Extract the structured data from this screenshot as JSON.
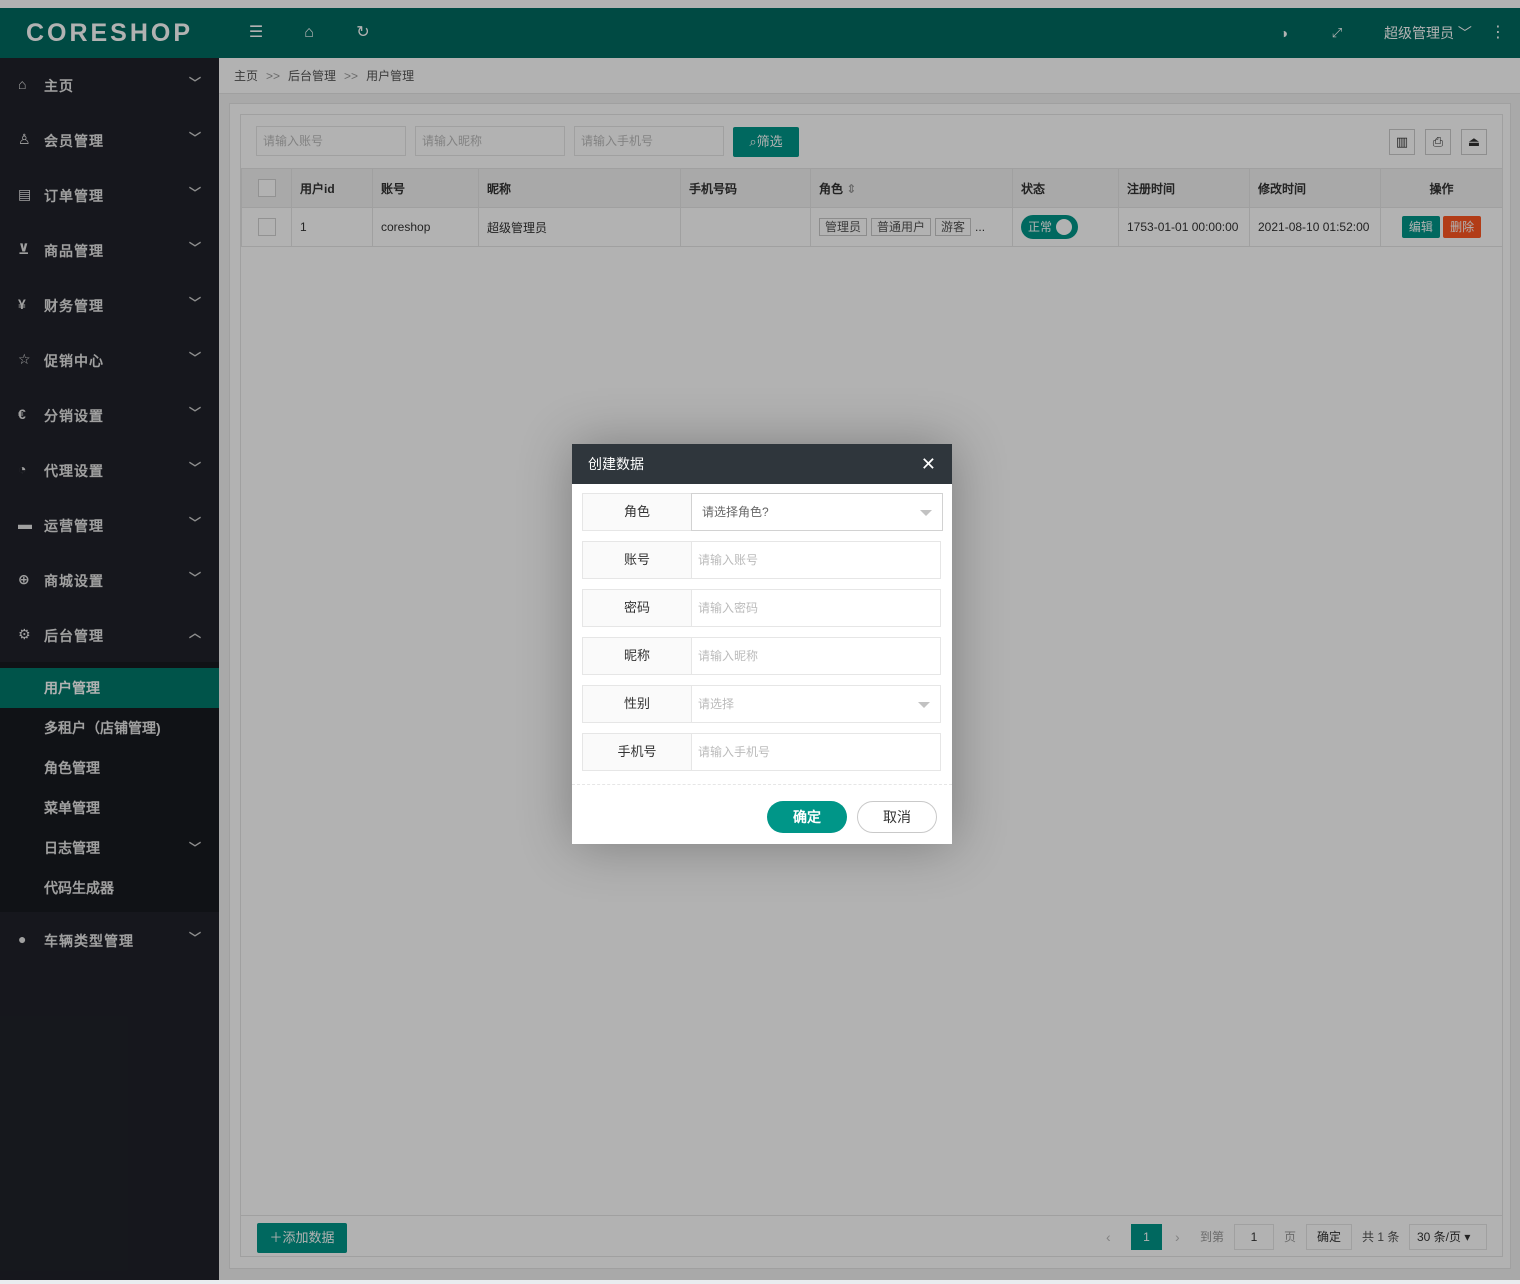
{
  "app": {
    "logo": "CORESHOP",
    "header_icons": [
      "menu-fold-icon",
      "home-icon",
      "refresh-icon",
      "theme-icon",
      "fullscreen-icon",
      "more-vertical-icon"
    ],
    "user_name": "超级管理员",
    "accent": "#009688",
    "header_bg": "#006b61",
    "sidebar_bg": "#20222a",
    "danger": "#ff5722"
  },
  "sidebar": {
    "items": [
      {
        "label": "主页",
        "icon": "home-icon"
      },
      {
        "label": "会员管理",
        "icon": "user-icon"
      },
      {
        "label": "订单管理",
        "icon": "order-icon"
      },
      {
        "label": "商品管理",
        "icon": "cart-icon"
      },
      {
        "label": "财务管理",
        "icon": "rmb-icon"
      },
      {
        "label": "促销中心",
        "icon": "star-icon"
      },
      {
        "label": "分销设置",
        "icon": "share-icon"
      },
      {
        "label": "代理设置",
        "icon": "dashboard-icon"
      },
      {
        "label": "运营管理",
        "icon": "chat-icon"
      },
      {
        "label": "商城设置",
        "icon": "globe-icon"
      },
      {
        "label": "后台管理",
        "icon": "gear-icon"
      }
    ],
    "sub_items": [
      {
        "label": "用户管理"
      },
      {
        "label": "多租户（店铺管理)"
      },
      {
        "label": "角色管理"
      },
      {
        "label": "菜单管理"
      },
      {
        "label": "日志管理"
      },
      {
        "label": "代码生成器"
      }
    ],
    "last_item": {
      "label": "车辆类型管理",
      "icon": "circle-icon"
    }
  },
  "breadcrumb": {
    "items": [
      "主页",
      "后台管理",
      "用户管理"
    ],
    "separator": ">>"
  },
  "filters": {
    "account_placeholder": "请输入账号",
    "nickname_placeholder": "请输入昵称",
    "phone_placeholder": "请输入手机号",
    "filter_button": "筛选"
  },
  "table": {
    "columns": [
      "用户id",
      "账号",
      "昵称",
      "手机号码",
      "角色",
      "状态",
      "注册时间",
      "修改时间",
      "操作"
    ],
    "rows": [
      {
        "id": "1",
        "account": "coreshop",
        "nickname": "超级管理员",
        "phone": "",
        "roles": [
          "管理员",
          "普通用户",
          "游客"
        ],
        "roles_more": "...",
        "status": "正常",
        "created": "1753-01-01 00:00:00",
        "modified": "2021-08-10 01:52:00",
        "edit": "编辑",
        "delete": "删除"
      }
    ]
  },
  "footer": {
    "add_button": "添加数据",
    "current_page": "1",
    "goto_label": "到第",
    "goto_value": "1",
    "page_unit": "页",
    "confirm": "确定",
    "total": "共 1 条",
    "page_size": "30 条/页"
  },
  "modal": {
    "title": "创建数据",
    "fields": [
      {
        "label": "角色",
        "placeholder": "请选择角色?",
        "type": "select"
      },
      {
        "label": "账号",
        "placeholder": "请输入账号",
        "type": "text"
      },
      {
        "label": "密码",
        "placeholder": "请输入密码",
        "type": "text"
      },
      {
        "label": "昵称",
        "placeholder": "请输入昵称",
        "type": "text"
      },
      {
        "label": "性别",
        "placeholder": "请选择",
        "type": "select"
      },
      {
        "label": "手机号",
        "placeholder": "请输入手机号",
        "type": "text"
      }
    ],
    "ok_button": "确定",
    "cancel_button": "取消"
  }
}
